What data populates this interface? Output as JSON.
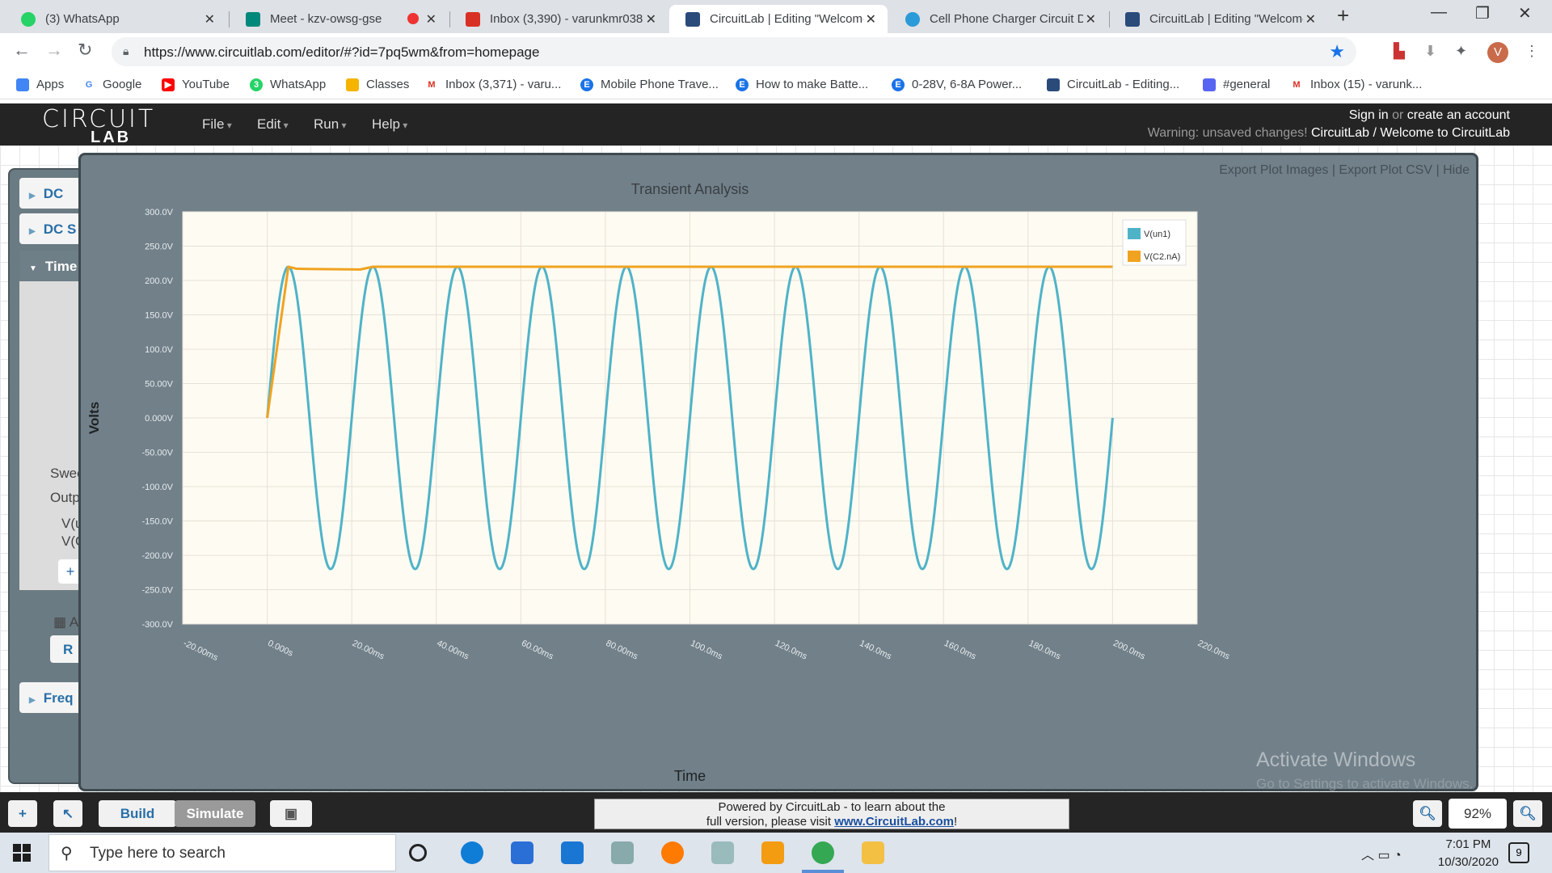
{
  "browser": {
    "tabs": [
      {
        "title": "(3) WhatsApp",
        "icon": "whatsapp-icon"
      },
      {
        "title": "Meet - kzv-owsg-gse",
        "icon": "meet-icon"
      },
      {
        "title": "Inbox (3,390) - varunkmr038",
        "icon": "gmail-icon"
      },
      {
        "title": "CircuitLab | Editing \"Welcome",
        "icon": "circuitlab-icon"
      },
      {
        "title": "Cell Phone Charger Circuit D",
        "icon": "globe-icon"
      },
      {
        "title": "CircuitLab | Editing \"Welcome",
        "icon": "circuitlab-icon"
      }
    ],
    "url": "https://www.circuitlab.com/editor/#?id=7pq5wm&from=homepage",
    "profile_initial": "V",
    "bookmarks": [
      {
        "label": "Apps",
        "icon": "apps-icon",
        "color": "#4285f4"
      },
      {
        "label": "Google",
        "icon": "google-icon",
        "color": "#4285f4"
      },
      {
        "label": "YouTube",
        "icon": "youtube-icon",
        "color": "#ff0000"
      },
      {
        "label": "WhatsApp",
        "icon": "whatsapp-icon",
        "color": "#25d366"
      },
      {
        "label": "Classes",
        "icon": "classroom-icon",
        "color": "#f4b400"
      },
      {
        "label": "Inbox (3,371) - varu...",
        "icon": "gmail-icon",
        "color": "#d93025"
      },
      {
        "label": "Mobile Phone Trave...",
        "icon": "e-icon",
        "color": "#1a73e8"
      },
      {
        "label": "How to make Batte...",
        "icon": "e-icon",
        "color": "#1a73e8"
      },
      {
        "label": "0-28V, 6-8A Power...",
        "icon": "e-icon",
        "color": "#1a73e8"
      },
      {
        "label": "CircuitLab - Editing...",
        "icon": "circuitlab-icon",
        "color": "#2a4a7a"
      },
      {
        "label": "#general",
        "icon": "discord-icon",
        "color": "#5865f2"
      },
      {
        "label": "Inbox (15) - varunk...",
        "icon": "gmail-icon",
        "color": "#d93025"
      }
    ]
  },
  "app": {
    "logo_top": "CIRCUIT",
    "logo_bottom": "LAB",
    "menus": [
      "File",
      "Edit",
      "Run",
      "Help"
    ],
    "sign_in": "Sign in",
    "sign_or": "or",
    "create_account": "create an account",
    "warning": "Warning: unsaved changes!",
    "doc_path": "CircuitLab / Welcome to CircuitLab"
  },
  "sim_panel": {
    "sections": [
      "DC",
      "DC S",
      "Time",
      "Freq"
    ],
    "labels": [
      "Swee",
      "Outp",
      "V(u",
      "V(C",
      "Ad",
      "R"
    ]
  },
  "plot": {
    "links": [
      "Export Plot Images",
      "Export Plot CSV",
      "Hide"
    ]
  },
  "chart_data": {
    "type": "line",
    "title": "Transient Analysis",
    "xlabel": "Time",
    "ylabel": "Volts",
    "x_ticks": [
      "-20.00ms",
      "0.000s",
      "20.00ms",
      "40.00ms",
      "60.00ms",
      "80.00ms",
      "100.0ms",
      "120.0ms",
      "140.0ms",
      "160.0ms",
      "180.0ms",
      "200.0ms",
      "220.0ms"
    ],
    "y_ticks": [
      "300.0V",
      "250.0V",
      "200.0V",
      "150.0V",
      "100.0V",
      "50.00V",
      "0.000V",
      "-50.00V",
      "-100.0V",
      "-150.0V",
      "-200.0V",
      "-250.0V",
      "-300.0V"
    ],
    "xlim_ms": [
      -20,
      220
    ],
    "ylim": [
      -300,
      300
    ],
    "legend_position": "top-right",
    "grid": true,
    "series": [
      {
        "name": "V(un1)",
        "color": "#4fb3c8",
        "kind": "sine",
        "amplitude_v": 220,
        "frequency_hz": 50,
        "t_start_ms": 0,
        "t_end_ms": 200
      },
      {
        "name": "V(C2.nA)",
        "color": "#f0a320",
        "kind": "rectified",
        "points_ms_v": [
          [
            0,
            0
          ],
          [
            5,
            220
          ],
          [
            7,
            217
          ],
          [
            22,
            216
          ],
          [
            25,
            220
          ],
          [
            200,
            220
          ]
        ]
      }
    ]
  },
  "bottom": {
    "build": "Build",
    "simulate": "Simulate",
    "powered_line1": "Powered by CircuitLab - to learn about the",
    "powered_line2": "full version, please visit",
    "powered_link": "www.CircuitLab.com",
    "powered_end": "!",
    "zoom": "92%"
  },
  "watermark": {
    "line1": "Activate Windows",
    "line2": "Go to Settings to activate Windows."
  },
  "taskbar": {
    "search_placeholder": "Type here to search",
    "time": "7:01 PM",
    "date": "10/30/2020",
    "notifications": "9"
  }
}
